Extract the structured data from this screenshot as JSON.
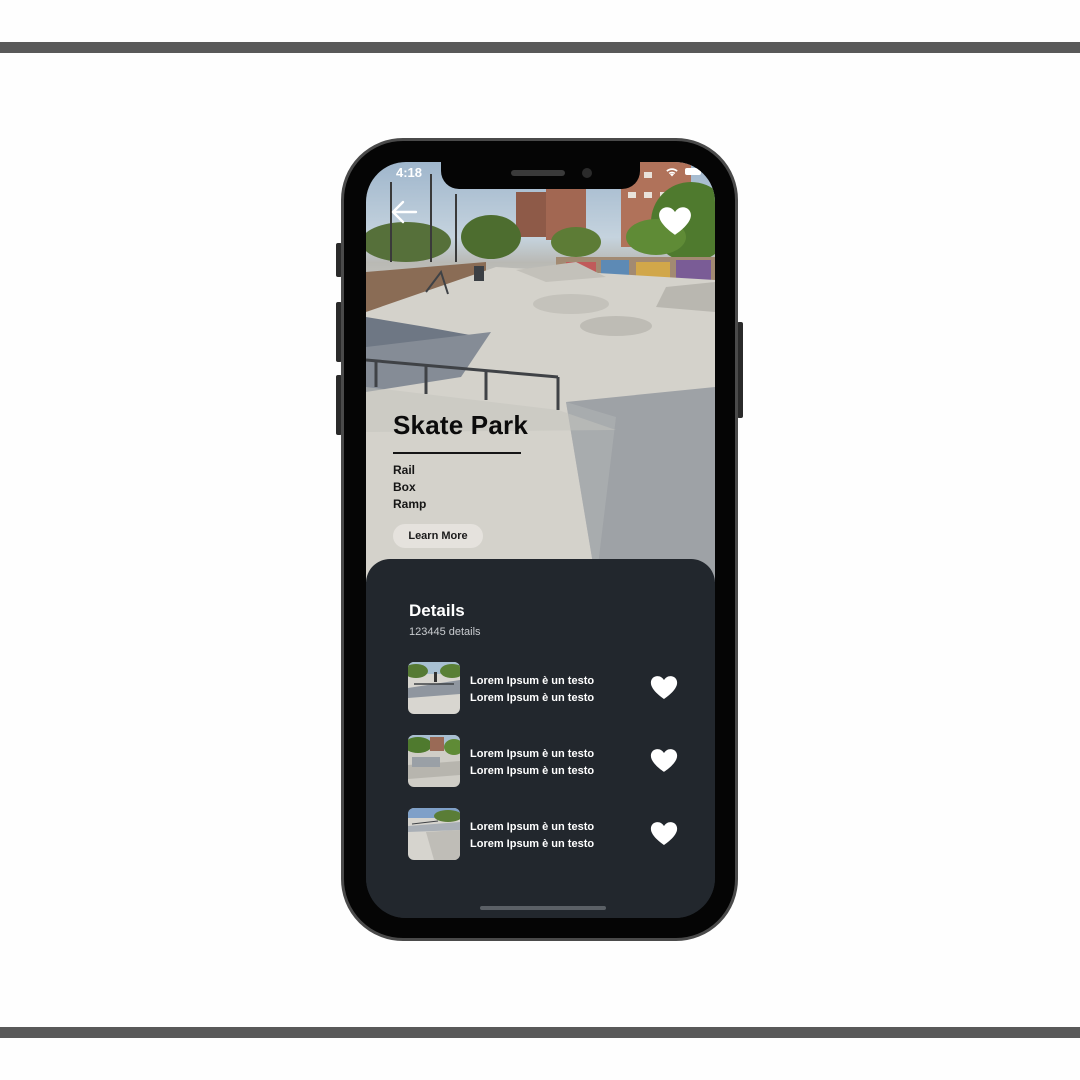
{
  "status_bar": {
    "time": "4:18",
    "wifi_icon": "wifi-icon",
    "battery_icon": "battery-icon"
  },
  "hero": {
    "back_icon": "arrow-left-icon",
    "favorite_icon": "heart-icon",
    "title": "Skate Park",
    "features": [
      "Rail",
      "Box",
      "Ramp"
    ],
    "learn_more_label": "Learn More"
  },
  "details": {
    "title": "Details",
    "count": "123445 details",
    "items": [
      {
        "line1": "Lorem Ipsum è un testo",
        "line2": "Lorem Ipsum è un testo",
        "favorite_icon": "heart-icon"
      },
      {
        "line1": "Lorem Ipsum è un testo",
        "line2": "Lorem Ipsum è un testo",
        "favorite_icon": "heart-icon"
      },
      {
        "line1": "Lorem Ipsum è un testo",
        "line2": "Lorem Ipsum è un testo",
        "favorite_icon": "heart-icon"
      }
    ]
  },
  "colors": {
    "panel_background": "#22272d",
    "phone_frame": "#050505",
    "accent_white": "#ffffff",
    "page_rule": "#595959"
  }
}
